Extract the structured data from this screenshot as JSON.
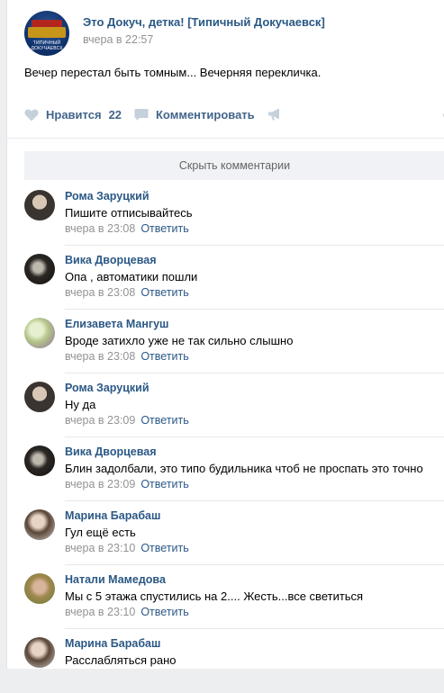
{
  "post": {
    "group_name": "Это Докуч, детка! [Типичный Докучаевск]",
    "time": "вчера в 22:57",
    "text": "Вечер перестал быть томным... Вечерняя перекличка.",
    "avatar_caption": "ТИПИЧНЫЙ ДОКУЧАЕВСК"
  },
  "actions": {
    "like_label": "Нравится",
    "like_count": "22",
    "comment_label": "Комментировать"
  },
  "hide_comments_label": "Скрыть комментарии",
  "comments": [
    {
      "author": "Рома Заруцкий",
      "text": "Пишите отписывайтесь",
      "time": "вчера в 23:08",
      "reply": "Ответить"
    },
    {
      "author": "Вика Дворцевая",
      "text": "Опа , автоматики пошли",
      "time": "вчера в 23:08",
      "reply": "Ответить"
    },
    {
      "author": "Елизавета Мангуш",
      "text": "Вроде затихло уже не так сильно слышно",
      "time": "вчера в 23:08",
      "reply": "Ответить"
    },
    {
      "author": "Рома Заруцкий",
      "text": "Ну да",
      "time": "вчера в 23:09",
      "reply": "Ответить"
    },
    {
      "author": "Вика Дворцевая",
      "text": "Блин задолбали, это типо будильника чтоб не проспать это точно",
      "time": "вчера в 23:09",
      "reply": "Ответить"
    },
    {
      "author": "Марина Барабаш",
      "text": "Гул ещё есть",
      "time": "вчера в 23:10",
      "reply": "Ответить"
    },
    {
      "author": "Натали Мамедова",
      "text": "Мы с 5 этажа спустились на 2.... Жесть...все светиться",
      "time": "вчера в 23:10",
      "reply": "Ответить"
    },
    {
      "author": "Марина Барабаш",
      "text": "Расслабляться рано",
      "time": "",
      "reply": ""
    }
  ],
  "colors": {
    "link": "#2a5885",
    "action": "#42648b",
    "muted": "#939393",
    "background": "#edeef0"
  },
  "icons": {
    "like": "heart-icon",
    "comment": "comment-icon",
    "share": "megaphone-icon"
  }
}
